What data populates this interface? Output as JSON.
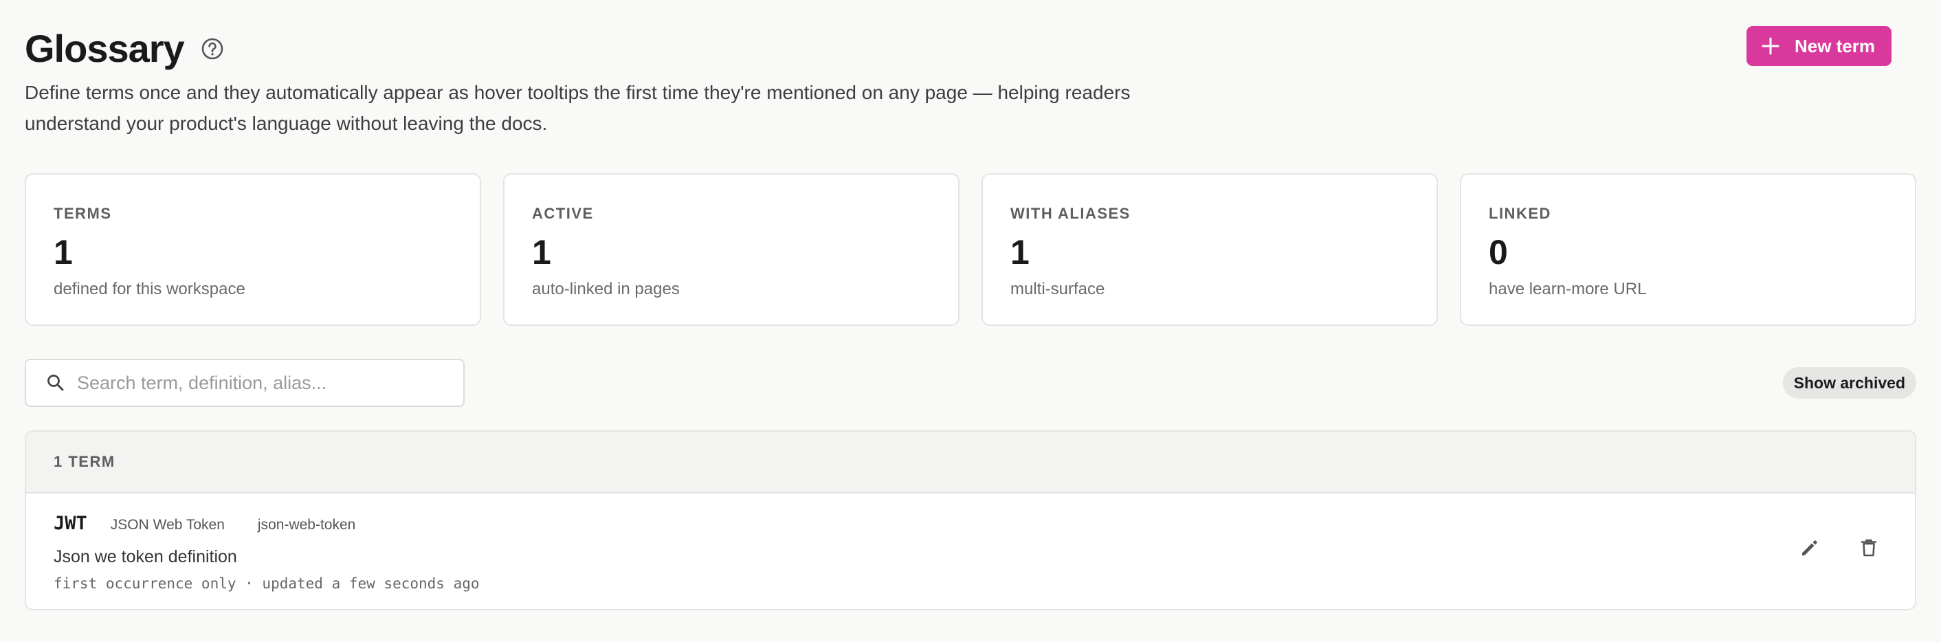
{
  "header": {
    "title": "Glossary",
    "description": "Define terms once and they automatically appear as hover tooltips the first time they're mentioned on any page — helping readers understand your product's language without leaving the docs.",
    "new_term_label": "New term"
  },
  "stats": [
    {
      "label": "TERMS",
      "value": "1",
      "sub": "defined for this workspace"
    },
    {
      "label": "ACTIVE",
      "value": "1",
      "sub": "auto-linked in pages"
    },
    {
      "label": "WITH ALIASES",
      "value": "1",
      "sub": "multi-surface"
    },
    {
      "label": "LINKED",
      "value": "0",
      "sub": "have learn-more URL"
    }
  ],
  "search": {
    "placeholder": "Search term, definition, alias...",
    "value": ""
  },
  "toolbar": {
    "show_archived_label": "Show archived"
  },
  "list": {
    "count_label": "1 TERM",
    "terms": [
      {
        "name": "JWT",
        "alias": "JSON Web Token",
        "slug": "json-web-token",
        "definition": "Json we token definition",
        "meta": "first occurrence only · updated a few seconds ago"
      }
    ]
  },
  "icons": {
    "help": "question-circle-icon",
    "plus": "plus-icon",
    "search": "search-icon",
    "edit": "pencil-icon",
    "delete": "trash-icon"
  },
  "colors": {
    "accent": "#d9399c",
    "background": "#f9f9f8",
    "card": "#ffffff",
    "border": "#e4e4e2"
  }
}
